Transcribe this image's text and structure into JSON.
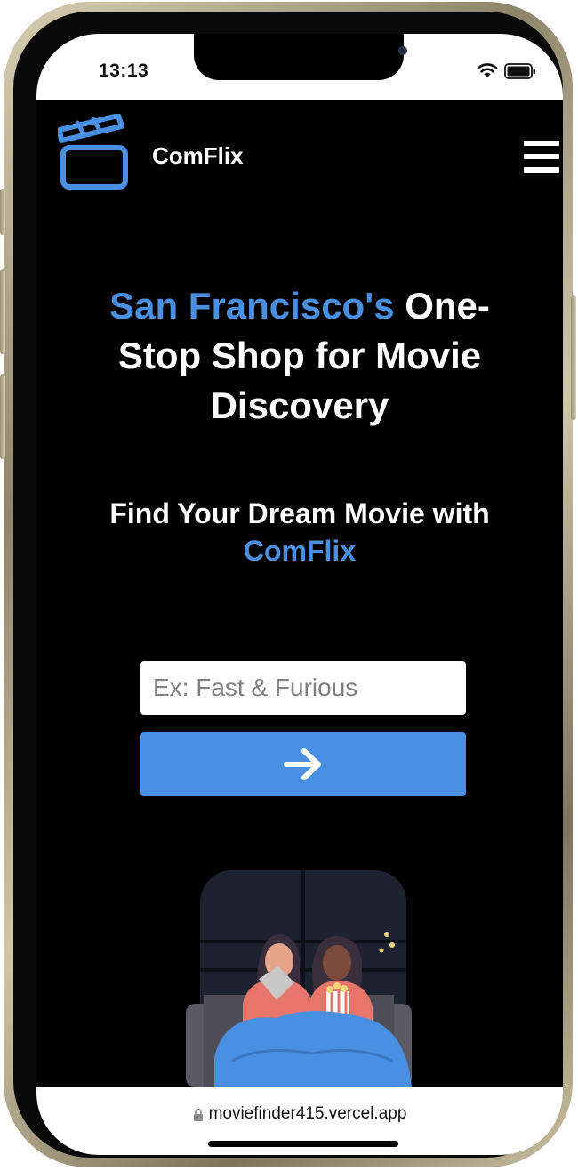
{
  "status_bar": {
    "time": "13:13"
  },
  "header": {
    "brand": "ComFlix",
    "logo_icon": "clapperboard-icon",
    "menu_icon": "hamburger-menu-icon"
  },
  "hero": {
    "title_accent": "San Francisco's",
    "title_rest": "One-Stop Shop for Movie Discovery",
    "subtitle_prefix": "Find Your Dream Movie with",
    "subtitle_accent": "ComFlix"
  },
  "search": {
    "placeholder": "Ex: Fast & Furious",
    "value": "",
    "button_icon": "arrow-right-icon"
  },
  "browser": {
    "url": "moviefinder415.vercel.app",
    "lock_icon": "lock-icon"
  },
  "colors": {
    "accent": "#4a90e2",
    "background": "#000000",
    "text": "#ffffff"
  }
}
